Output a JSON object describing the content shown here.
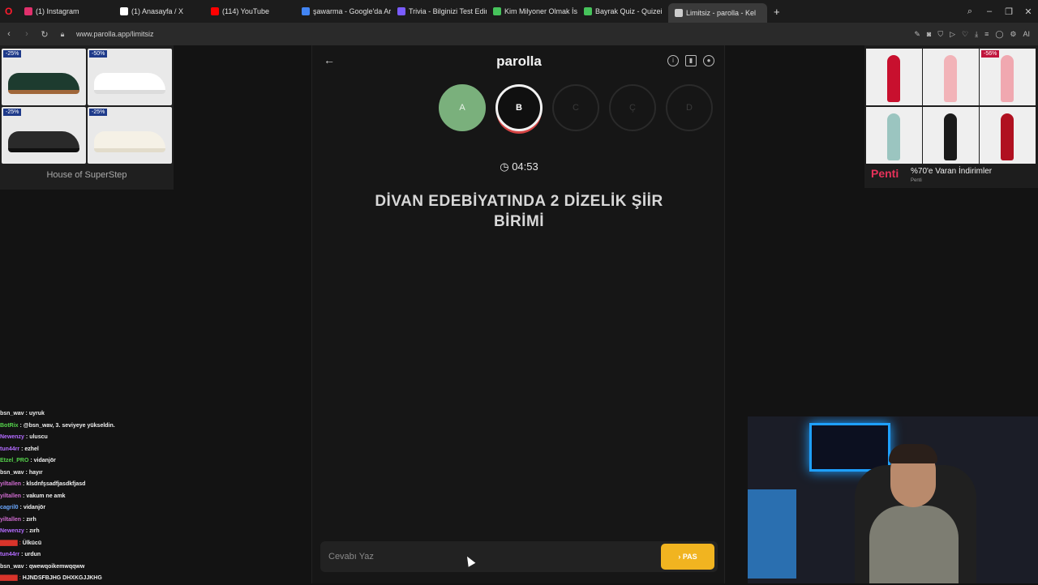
{
  "browser": {
    "tabs": [
      {
        "label": "(1) Instagram",
        "fav_color": "#e1306c",
        "active": false
      },
      {
        "label": "(1) Anasayfa / X",
        "fav_color": "#ffffff",
        "active": false
      },
      {
        "label": "(114) YouTube",
        "fav_color": "#ff0000",
        "active": false
      },
      {
        "label": "şawarma - Google'da Ara",
        "fav_color": "#4285f4",
        "active": false
      },
      {
        "label": "Trivia - Bilginizi Test Edin",
        "fav_color": "#7a5cff",
        "active": false
      },
      {
        "label": "Kim Milyoner Olmak İster",
        "fav_color": "#46c35b",
        "active": false
      },
      {
        "label": "Bayrak Quiz - Quizei",
        "fav_color": "#46c35b",
        "active": false
      },
      {
        "label": "Limitsiz - parolla - Kel",
        "fav_color": "#cccccc",
        "active": true
      }
    ],
    "url": "www.parolla.app/limitsiz",
    "addr_right_label": "AI"
  },
  "left_ad": {
    "discounts": [
      "-25%",
      "-50%",
      "-25%",
      "-25%"
    ],
    "brand": "House of SuperStep"
  },
  "chat": [
    {
      "user": "bsn_wav",
      "msg": "uyruk",
      "color": "#e8e8e8"
    },
    {
      "user": "BotRix",
      "msg": "@bsn_wav, 3. seviyeye yükseldin.",
      "color": "#56d44c"
    },
    {
      "user": "Newenzy",
      "msg": "uluscu",
      "color": "#b36bff"
    },
    {
      "user": "tun44rr",
      "msg": "ezhel",
      "color": "#b36bff"
    },
    {
      "user": "Etzel_PRO",
      "msg": "vidanjör",
      "color": "#56d44c"
    },
    {
      "user": "bsn_wav",
      "msg": "hayır",
      "color": "#e8e8e8"
    },
    {
      "user": "yiltallen",
      "msg": "klsdnfşsadfjasdkfjasd",
      "color": "#d06bd0"
    },
    {
      "user": "yiltallen",
      "msg": "vakum ne amk",
      "color": "#d06bd0"
    },
    {
      "user": "cagril0",
      "msg": "vidanjör",
      "color": "#6ba8ff"
    },
    {
      "user": "yiltallen",
      "msg": "zırh",
      "color": "#d06bd0"
    },
    {
      "user": "Newenzy",
      "msg": "zırh",
      "color": "#b36bff"
    },
    {
      "user": "",
      "msg": "Ülkücü",
      "color": "#d9342b"
    },
    {
      "user": "tun44rr",
      "msg": "urdun",
      "color": "#b36bff"
    },
    {
      "user": "bsn_wav",
      "msg": "qwewqoikemwqqww",
      "color": "#e8e8e8"
    },
    {
      "user": "",
      "msg": "HJNDSFBJHG DHXKGJJKHG",
      "color": "#d9342b"
    }
  ],
  "game": {
    "logo": "parolla",
    "letters": [
      {
        "label": "A",
        "state": "done"
      },
      {
        "label": "B",
        "state": "current"
      },
      {
        "label": "C",
        "state": "pending"
      },
      {
        "label": "Ç",
        "state": "pending"
      },
      {
        "label": "D",
        "state": "pending"
      }
    ],
    "timer": "04:53",
    "question": "DİVAN EDEBİYATINDA 2 DİZELİK ŞİİR BİRİMİ",
    "answer_placeholder": "Cevabı Yaz",
    "pass_label": "PAS"
  },
  "right_ad": {
    "discount": "-56%",
    "logo": "Penti",
    "title": "%70'e Varan İndirimler",
    "subtitle": "Penti"
  },
  "colors": {
    "done": "#7ab07c",
    "current_ring": "#f2f2f2",
    "pass": "#f1b420"
  }
}
